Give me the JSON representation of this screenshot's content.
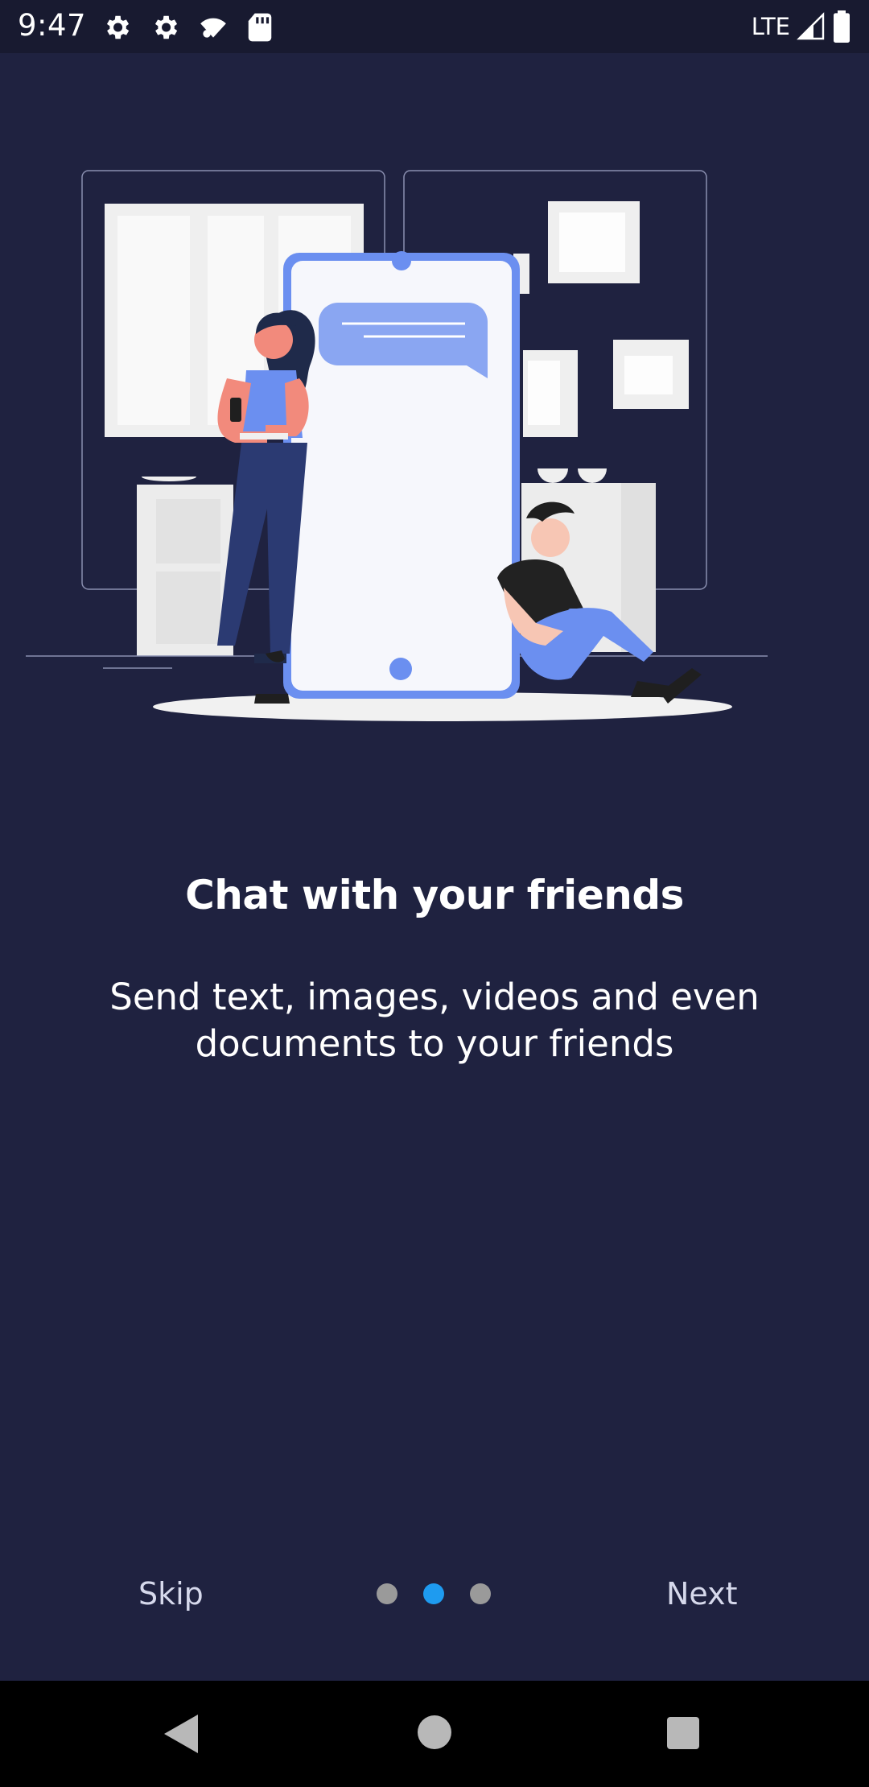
{
  "status_bar": {
    "time": "9:47",
    "network": "LTE",
    "icons": [
      "settings-icon",
      "settings-icon",
      "signal-wifi-icon",
      "sd-card-icon",
      "cell-signal-icon",
      "battery-icon"
    ]
  },
  "onboarding": {
    "title": "Chat with your friends",
    "description": "Send text, images, videos and even documents to your friends",
    "illustration": "two people chatting on phones beside a large phone"
  },
  "pager": {
    "skip_label": "Skip",
    "next_label": "Next",
    "current_page": 2,
    "total_pages": 3
  },
  "colors": {
    "background": "#1f2240",
    "accent_dot": "#1e9bf0",
    "inactive_dot": "#9a9a9a",
    "illustration_blue": "#6b8ff0"
  },
  "nav_bar": {
    "icons": [
      "back-icon",
      "home-icon",
      "recents-icon"
    ]
  }
}
